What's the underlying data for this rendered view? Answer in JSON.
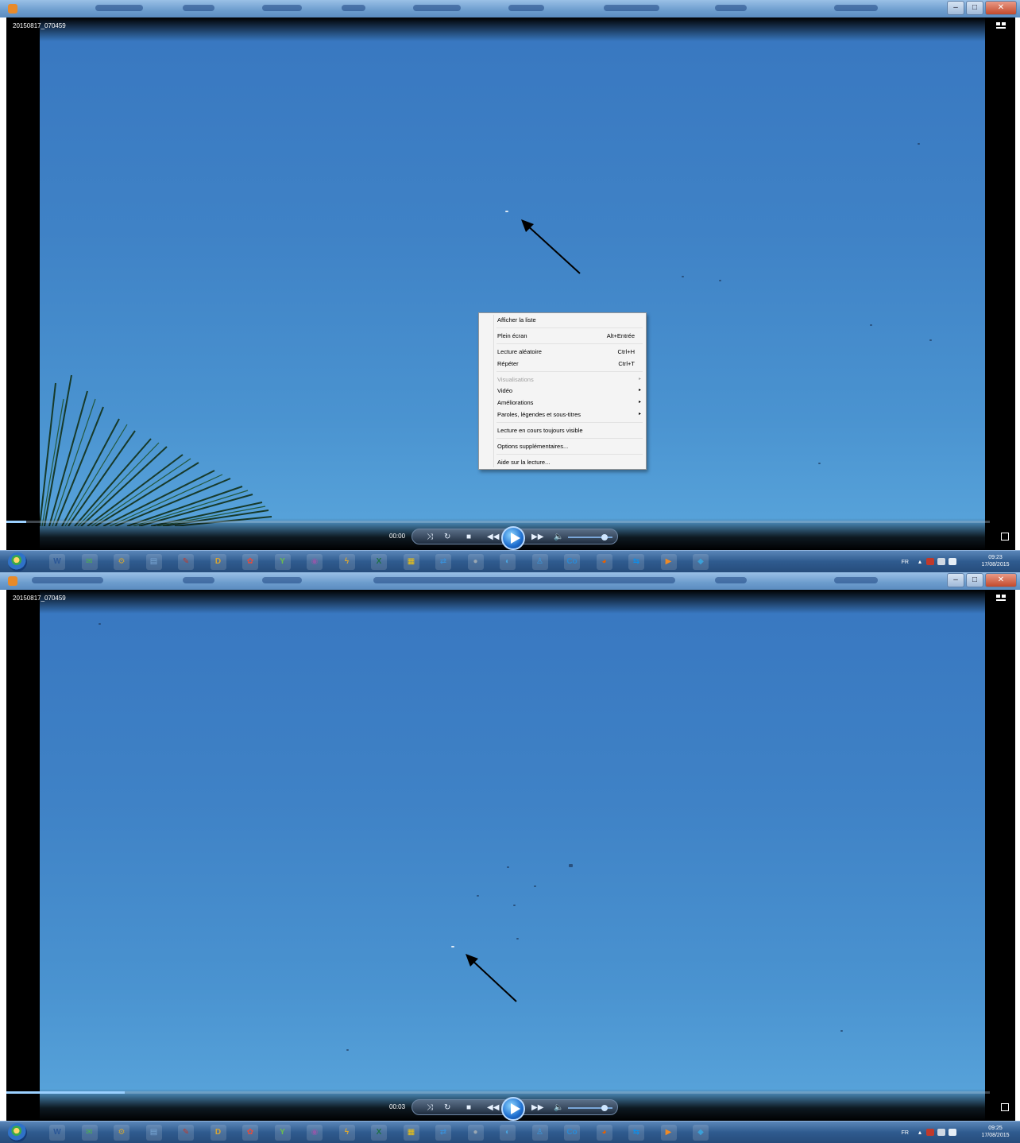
{
  "panels": [
    {
      "file_title": "20150817_070459",
      "time": "00:00",
      "seek_progress": 0.02,
      "clock_time": "09:23",
      "clock_date": "17/08/2015",
      "context_menu": {
        "items": [
          {
            "label": "Afficher la liste",
            "shortcut": "",
            "submenu": false,
            "disabled": false
          },
          {
            "label": "Plein écran",
            "shortcut": "Alt+Entrée",
            "submenu": false,
            "disabled": false
          },
          {
            "label": "Lecture aléatoire",
            "shortcut": "Ctrl+H",
            "submenu": false,
            "disabled": false
          },
          {
            "label": "Répéter",
            "shortcut": "Ctrl+T",
            "submenu": false,
            "disabled": false
          },
          {
            "label": "Visualisations",
            "shortcut": "",
            "submenu": true,
            "disabled": true
          },
          {
            "label": "Vidéo",
            "shortcut": "",
            "submenu": true,
            "disabled": false
          },
          {
            "label": "Améliorations",
            "shortcut": "",
            "submenu": true,
            "disabled": false
          },
          {
            "label": "Paroles, légendes et sous-titres",
            "shortcut": "",
            "submenu": true,
            "disabled": false
          },
          {
            "label": "Lecture en cours toujours visible",
            "shortcut": "",
            "submenu": false,
            "disabled": false
          },
          {
            "label": "Options supplémentaires...",
            "shortcut": "",
            "submenu": false,
            "disabled": false
          },
          {
            "label": "Aide sur la lecture...",
            "shortcut": "",
            "submenu": false,
            "disabled": false
          }
        ]
      }
    },
    {
      "file_title": "20150817_070459",
      "time": "00:03",
      "seek_progress": 0.12,
      "clock_time": "09:25",
      "clock_date": "17/08/2015"
    }
  ],
  "taskbar": {
    "language": "FR",
    "icons": [
      {
        "name": "word-icon",
        "glyph": "W",
        "color": "#2b5797"
      },
      {
        "name": "mail-icon",
        "glyph": "✉",
        "color": "#4caf50"
      },
      {
        "name": "settings-icon",
        "glyph": "⚙",
        "color": "#caa43a"
      },
      {
        "name": "explorer-icon",
        "glyph": "▤",
        "color": "#7aa8d6"
      },
      {
        "name": "editor-icon",
        "glyph": "✎",
        "color": "#c0392b"
      },
      {
        "name": "d-app-icon",
        "glyph": "D",
        "color": "#d8a533"
      },
      {
        "name": "paint-icon",
        "glyph": "✿",
        "color": "#e74c3c"
      },
      {
        "name": "tools-icon",
        "glyph": "Y",
        "color": "#6bbf4a"
      },
      {
        "name": "media-center-icon",
        "glyph": "◉",
        "color": "#8e5aa8"
      },
      {
        "name": "flash-icon",
        "glyph": "ϟ",
        "color": "#e0a82e"
      },
      {
        "name": "excel-icon",
        "glyph": "X",
        "color": "#1e7145"
      },
      {
        "name": "notes-icon",
        "glyph": "▦",
        "color": "#f1c40f"
      },
      {
        "name": "network-icon",
        "glyph": "⇄",
        "color": "#3a8fd8"
      },
      {
        "name": "disk-icon",
        "glyph": "●",
        "color": "#9aa7b3"
      },
      {
        "name": "photo-icon",
        "glyph": "◐",
        "color": "#4aa3df"
      },
      {
        "name": "user-icon",
        "glyph": "♙",
        "color": "#3b9be0"
      },
      {
        "name": "co-app-icon",
        "glyph": "Co",
        "color": "#2a8ad6"
      },
      {
        "name": "firefox-icon",
        "glyph": "◕",
        "color": "#e66000"
      },
      {
        "name": "teamviewer-icon",
        "glyph": "⇆",
        "color": "#0e8ee9"
      },
      {
        "name": "media-player-icon",
        "glyph": "▶",
        "color": "#f08a24"
      },
      {
        "name": "maps-icon",
        "glyph": "◆",
        "color": "#3aa0d8"
      }
    ]
  },
  "colors": {
    "sky_top": "#3877c0",
    "sky_bottom": "#5aa6dc",
    "taskbar": "#2f5b8f",
    "play_button": "#1e6fd0"
  }
}
